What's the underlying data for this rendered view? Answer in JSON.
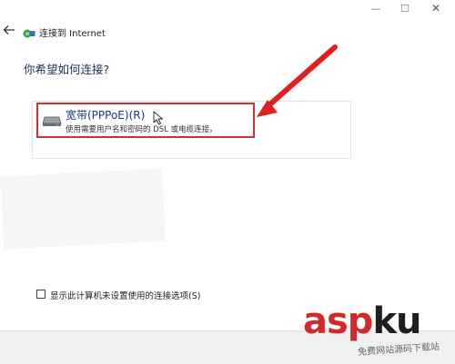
{
  "window": {
    "buttons": {
      "minimize": "—",
      "maximize": "☐",
      "close": "✕"
    }
  },
  "dialog": {
    "back_icon": "back-arrow-icon",
    "title": "连接到 Internet",
    "question": "你希望如何连接?"
  },
  "option": {
    "title": "宽带(PPPoE)(R)",
    "description": "使用需要用户名和密码的 DSL 或电缆连接。",
    "icon": "broadband-modem-icon"
  },
  "checkbox": {
    "label": "显示此计算机未设置使用的连接选项(S)",
    "checked": false
  },
  "annotation": {
    "color": "#e02020"
  },
  "watermark": {
    "brand_part1": "asp",
    "brand_part2": "ku",
    "tagline": "免费网站源码下载站"
  },
  "colors": {
    "highlight_border": "#d32f2f",
    "question_text": "#1f2f5a",
    "option_title": "#1a3a8a"
  }
}
